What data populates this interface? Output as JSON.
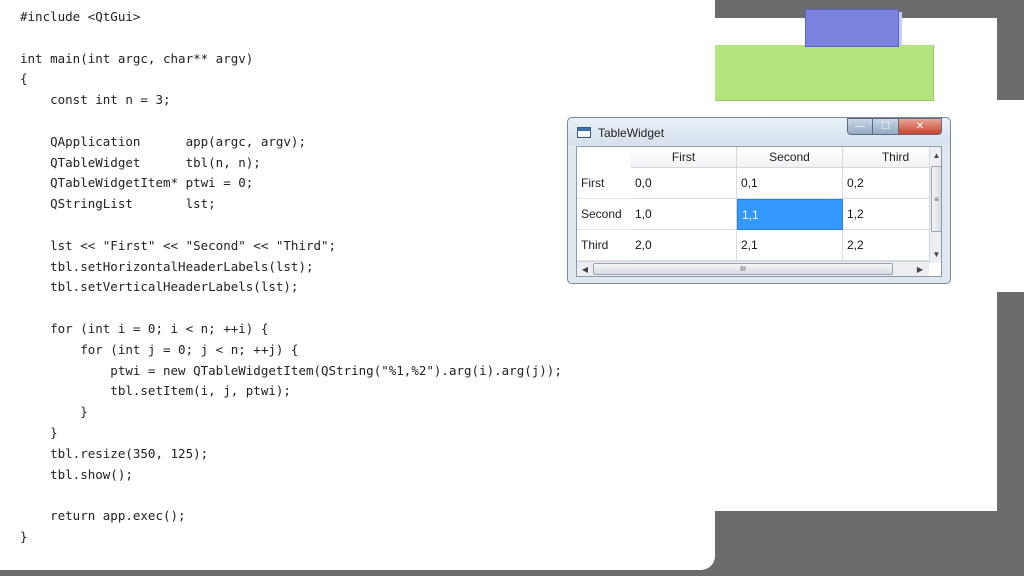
{
  "code": {
    "lines": [
      "#include <QtGui>",
      "",
      "int main(int argc, char** argv)",
      "{",
      "    const int n = 3;",
      "",
      "    QApplication      app(argc, argv);",
      "    QTableWidget      tbl(n, n);",
      "    QTableWidgetItem* ptwi = 0;",
      "    QStringList       lst;",
      "",
      "    lst << \"First\" << \"Second\" << \"Third\";",
      "    tbl.setHorizontalHeaderLabels(lst);",
      "    tbl.setVerticalHeaderLabels(lst);",
      "",
      "    for (int i = 0; i < n; ++i) {",
      "        for (int j = 0; j < n; ++j) {",
      "            ptwi = new QTableWidgetItem(QString(\"%1,%2\").arg(i).arg(j));",
      "            tbl.setItem(i, j, ptwi);",
      "        }",
      "    }",
      "    tbl.resize(350, 125);",
      "    tbl.show();",
      "",
      "    return app.exec();",
      "}"
    ]
  },
  "window": {
    "title": "TableWidget",
    "buttons": {
      "minimize": "—",
      "maximize": "☐",
      "close": "✕"
    }
  },
  "table": {
    "columns": [
      "First",
      "Second",
      "Third"
    ],
    "rows": [
      {
        "header": "First",
        "cells": [
          "0,0",
          "0,1",
          "0,2"
        ]
      },
      {
        "header": "Second",
        "cells": [
          "1,0",
          "1,1",
          "1,2"
        ]
      },
      {
        "header": "Third",
        "cells": [
          "2,0",
          "2,1",
          "2,2"
        ]
      }
    ],
    "selected_cell": "1,1",
    "scrollbars": {
      "up_arrow": "▲",
      "down_arrow": "▼",
      "left_arrow": "◀",
      "right_arrow": "▶",
      "v_grip": "≡",
      "h_grip": "III"
    }
  },
  "colors": {
    "selection": "#3399ff",
    "blue_shape": "#7b83e0",
    "green_shape": "#b4e37f",
    "background": "#6b6b6b"
  }
}
